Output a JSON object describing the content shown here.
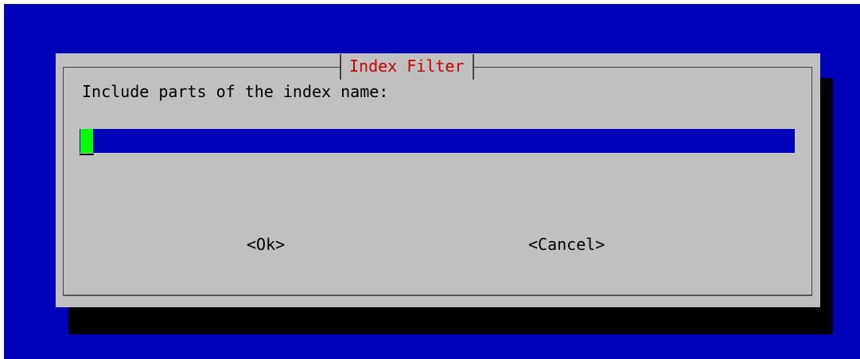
{
  "dialog": {
    "title": "Index Filter",
    "prompt": "Include parts of the index name:",
    "input": {
      "value": ""
    },
    "buttons": {
      "ok": "<Ok>",
      "cancel": "<Cancel>"
    }
  },
  "colors": {
    "background": "#0000b8",
    "dialog": "#c0c0c0",
    "title": "#c80000",
    "cursor": "#00ff00",
    "shadow": "#000000"
  }
}
